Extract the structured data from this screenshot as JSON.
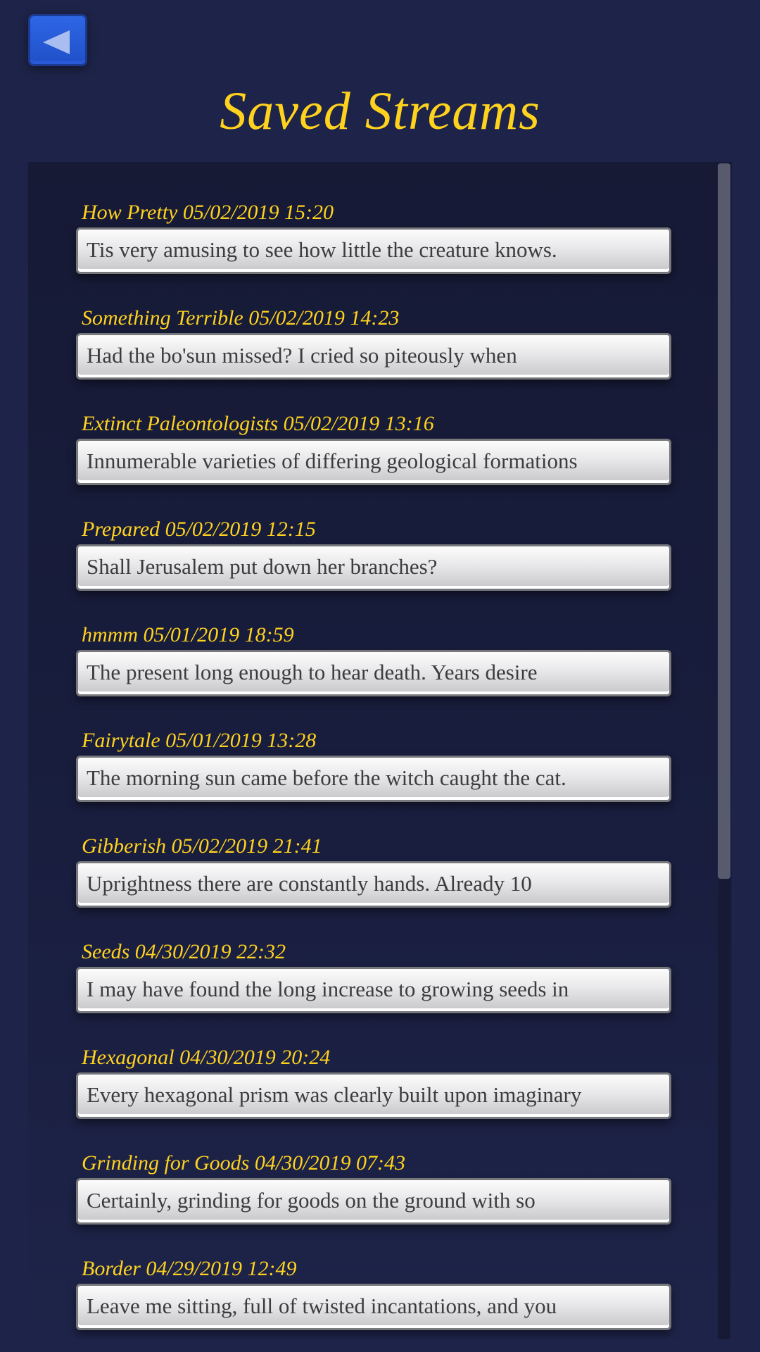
{
  "header": {
    "back_button_icon": "back-triangle-icon",
    "title": "Saved Streams"
  },
  "colors": {
    "background": "#1e2449",
    "accent_yellow": "#ffd21e",
    "back_button_blue": "#2a5ad8"
  },
  "streams": [
    {
      "label": "How Pretty 05/02/2019 15:20",
      "preview": "Tis very amusing to see how little the creature knows."
    },
    {
      "label": "Something Terrible 05/02/2019 14:23",
      "preview": "Had the bo'sun missed? I cried so piteously when"
    },
    {
      "label": "Extinct Paleontologists 05/02/2019 13:16",
      "preview": "Innumerable varieties of differing geological formations"
    },
    {
      "label": "Prepared 05/02/2019 12:15",
      "preview": "Shall Jerusalem put down her branches?"
    },
    {
      "label": "hmmm 05/01/2019 18:59",
      "preview": "The present long enough to hear death. Years desire"
    },
    {
      "label": "Fairytale 05/01/2019 13:28",
      "preview": "The morning sun came before the witch caught the cat."
    },
    {
      "label": "Gibberish 05/02/2019 21:41",
      "preview": "Uprightness there are constantly hands. Already 10"
    },
    {
      "label": "Seeds 04/30/2019 22:32",
      "preview": "I may have found the long increase to growing seeds in"
    },
    {
      "label": "Hexagonal 04/30/2019 20:24",
      "preview": "Every hexagonal prism was clearly built upon imaginary"
    },
    {
      "label": "Grinding for Goods 04/30/2019 07:43",
      "preview": "Certainly, grinding for goods on the ground with so"
    },
    {
      "label": "Border 04/29/2019 12:49",
      "preview": "Leave me sitting, full of twisted incantations, and you"
    }
  ]
}
